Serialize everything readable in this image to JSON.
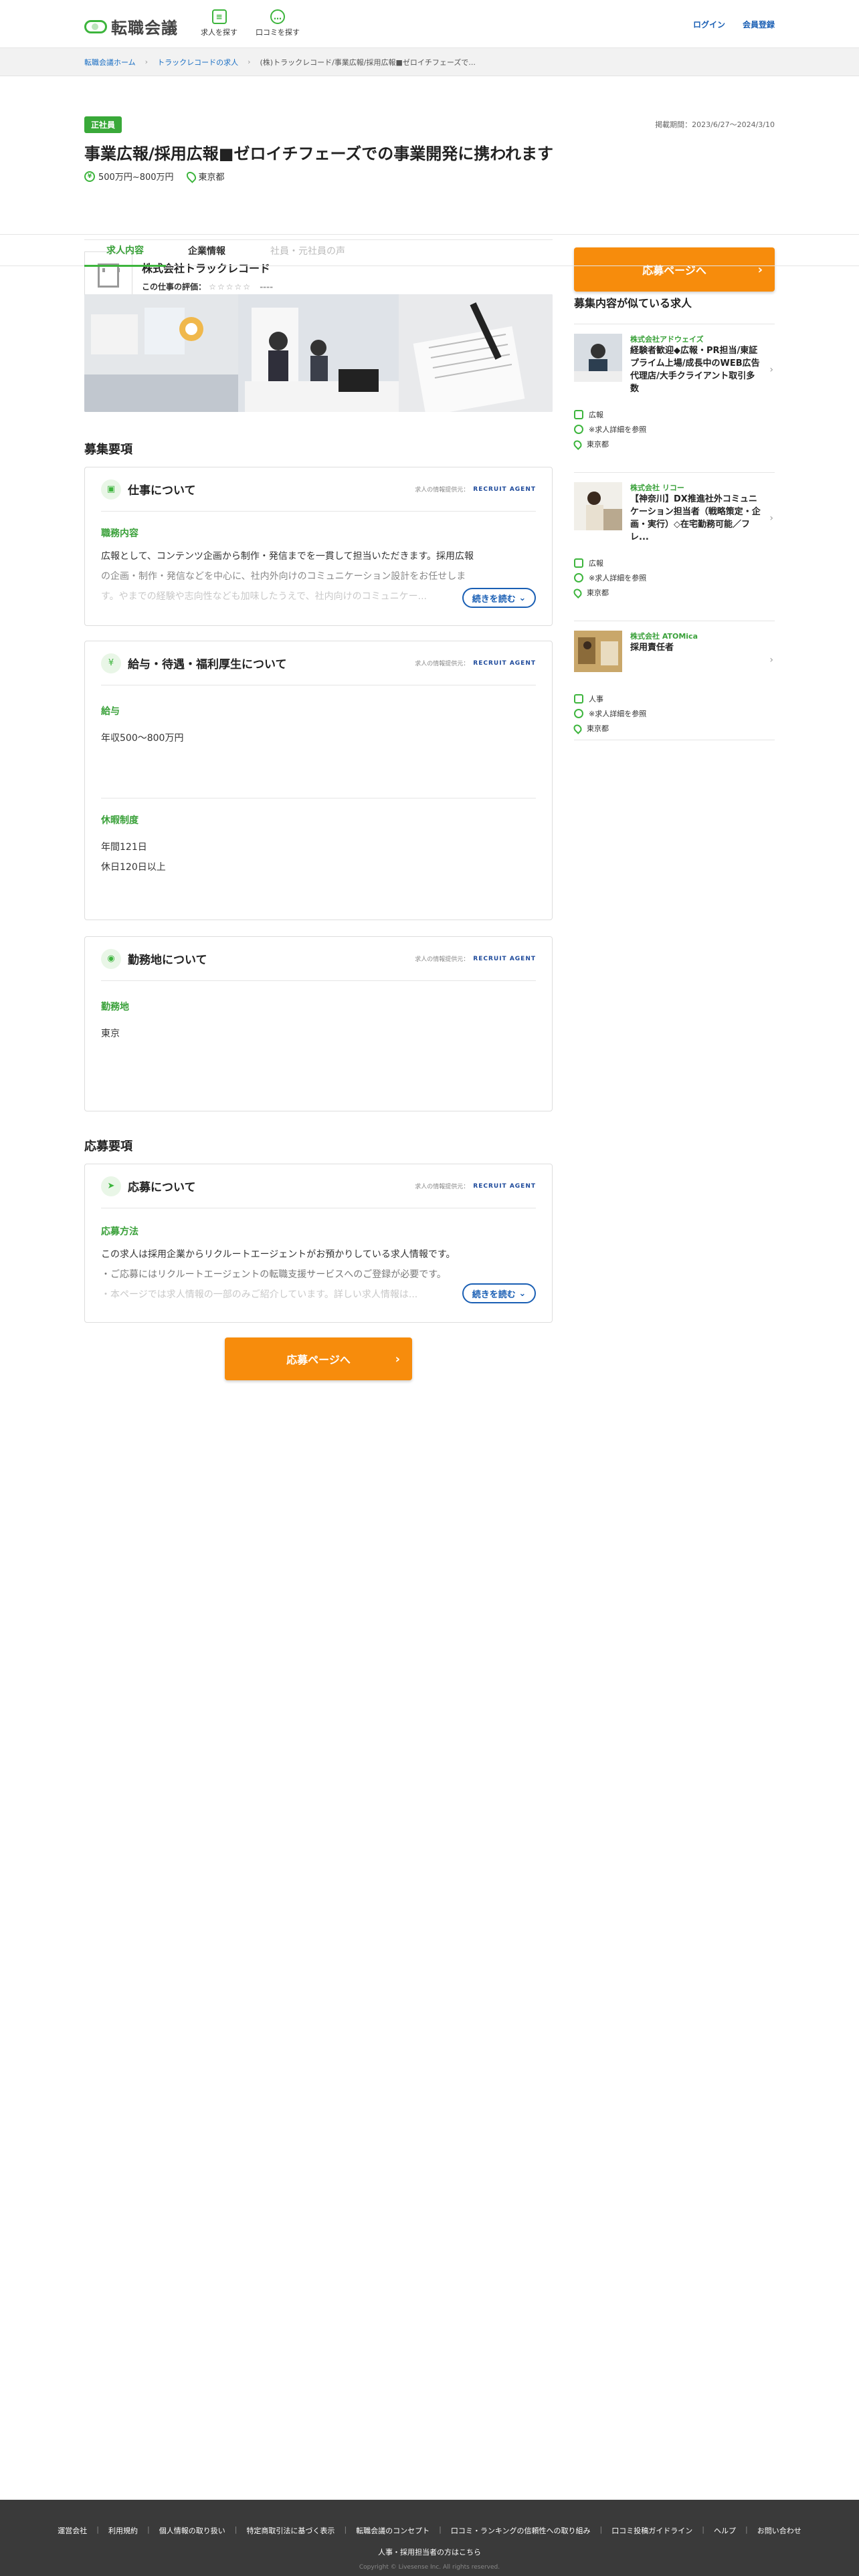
{
  "header": {
    "logo_text": "転職会議",
    "nav": [
      {
        "label": "求人を探す"
      },
      {
        "label": "口コミを探す"
      }
    ],
    "login": "ログイン",
    "register": "会員登録"
  },
  "breadcrumb": [
    "転職会議ホーム",
    "トラックレコードの求人",
    "(株)トラックレコード/事業広報/採用広報■ゼロイチフェーズで..."
  ],
  "job": {
    "badge": "正社員",
    "period": "掲載期間：2023/6/27〜2024/3/10",
    "title": "事業広報/採用広報■ゼロイチフェーズでの事業開発に携われます",
    "salary": "500万円~800万円",
    "location": "東京都",
    "company": "株式会社トラックレコード",
    "rating_label": "この仕事の評価：",
    "stars": "☆☆☆☆☆",
    "rating_value": "----",
    "apply": "応募ページへ"
  },
  "tabs": [
    "求人内容",
    "企業情報",
    "社員・元社員の声"
  ],
  "sections": {
    "recruit_heading": "募集要項",
    "apply_heading": "応募要項",
    "source_label": "求人の情報提供元：",
    "source_brand": "RECRUIT AGENT",
    "readmore": "続きを読む",
    "work": {
      "title": "仕事について",
      "label": "職務内容",
      "line1": "広報として、コンテンツ企画から制作・発信までを一貫して担当いただきます。採用広報",
      "line2": "の企画・制作・発信などを中心に、社内外向けのコミュニケーション設計をお任せしま",
      "line3": "す。やまでの経験や志向性なども加味したうえで、社内向けのコミュニケー..."
    },
    "salary": {
      "title": "給与・待遇・福利厚生について",
      "label": "給与",
      "value": "年収500〜800万円",
      "holiday_label": "休暇制度",
      "holiday1": "年間121日",
      "holiday2": "休日120日以上"
    },
    "location": {
      "title": "勤務地について",
      "label": "勤務地",
      "value": "東京"
    },
    "apply": {
      "title": "応募について",
      "label": "応募方法",
      "line1": "この求人は採用企業からリクルートエージェントがお預かりしている求人情報です。",
      "line2": "・ご応募にはリクルートエージェントの転職支援サービスへのご登録が必要です。",
      "line3": "・本ページでは求人情報の一部のみご紹介しています。詳しい求人情報は..."
    }
  },
  "side": {
    "heading": "募集内容が似ている求人",
    "jobs": [
      {
        "company": "株式会社アドウェイズ",
        "title": "経験者歓迎◆広報・PR担当/東証プライム上場/成長中のWEB広告代理店/大手クライアント取引多数",
        "tag1": "広報",
        "tag2": "※求人詳細を参照",
        "tag3": "東京都"
      },
      {
        "company": "株式会社 リコー",
        "title": "【神奈川】DX推進社外コミュニケーション担当者（戦略策定・企画・実行）◇在宅勤務可能／フレ...",
        "tag1": "広報",
        "tag2": "※求人詳細を参照",
        "tag3": "東京都"
      },
      {
        "company": "株式会社 ATOMica",
        "title": "採用責任者",
        "tag1": "人事",
        "tag2": "※求人詳細を参照",
        "tag3": "東京都"
      }
    ]
  },
  "footer": {
    "links": [
      "運営会社",
      "利用規約",
      "個人情報の取り扱い",
      "特定商取引法に基づく表示",
      "転職会議のコンセプト",
      "口コミ・ランキングの信頼性への取り組み",
      "口コミ投稿ガイドライン",
      "ヘルプ",
      "お問い合わせ"
    ],
    "hr_link": "人事・採用担当者の方はこちら",
    "copyright": "Copyright © Livesense Inc. All rights reserved."
  }
}
